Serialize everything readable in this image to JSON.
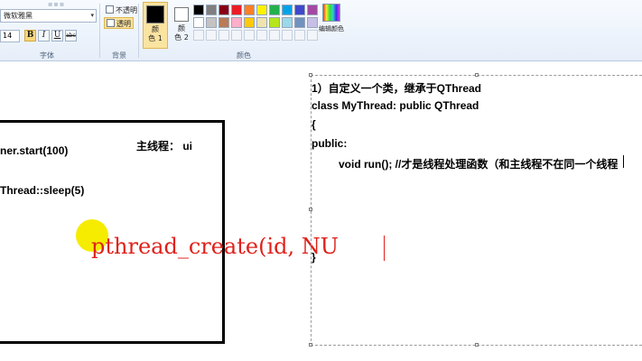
{
  "ribbon": {
    "font_group": {
      "font_name": "微软雅黑",
      "font_size": "14",
      "bold": "B",
      "italic": "I",
      "underline": "U",
      "strike": "abc",
      "label": "字体"
    },
    "background_group": {
      "opaque": "不透明",
      "transparent": "透明",
      "label": "背景",
      "selected": "透明"
    },
    "colors_group": {
      "color1_label_line1": "颜",
      "color1_label_line2": "色 1",
      "color2_label_line1": "颜",
      "color2_label_line2": "色 2",
      "edit_colors": "编辑颜色",
      "label": "颜色",
      "color1": "#000000",
      "color2": "#ffffff",
      "palette_row1": [
        "#000000",
        "#7f7f7f",
        "#880015",
        "#ed1c24",
        "#ff7f27",
        "#fff200",
        "#22b14c",
        "#00a2e8",
        "#3f48cc",
        "#a349a4"
      ],
      "palette_row2": [
        "#ffffff",
        "#c3c3c3",
        "#b97a57",
        "#ffaec9",
        "#ffc90e",
        "#efe4b0",
        "#b5e61d",
        "#99d9ea",
        "#7092be",
        "#c8bfe7"
      ]
    }
  },
  "canvas": {
    "left_notes": {
      "timer_start": "ner.start(100)",
      "main_thread": "主线程： ui",
      "sleep": "Thread::sleep(5)"
    },
    "big_code": "pthread_create(id, NU",
    "text_box": {
      "line1": "1）自定义一个类，继承于QThread",
      "line2": "class MyThread: public QThread",
      "line3": "{",
      "line4": "public:",
      "line5": "void run(); //才是线程处理函数（和主线程不在同一个线程",
      "line6": "}"
    }
  },
  "accent": {
    "highlight_yellow": "#f5ec00",
    "code_red": "#e0201a"
  }
}
